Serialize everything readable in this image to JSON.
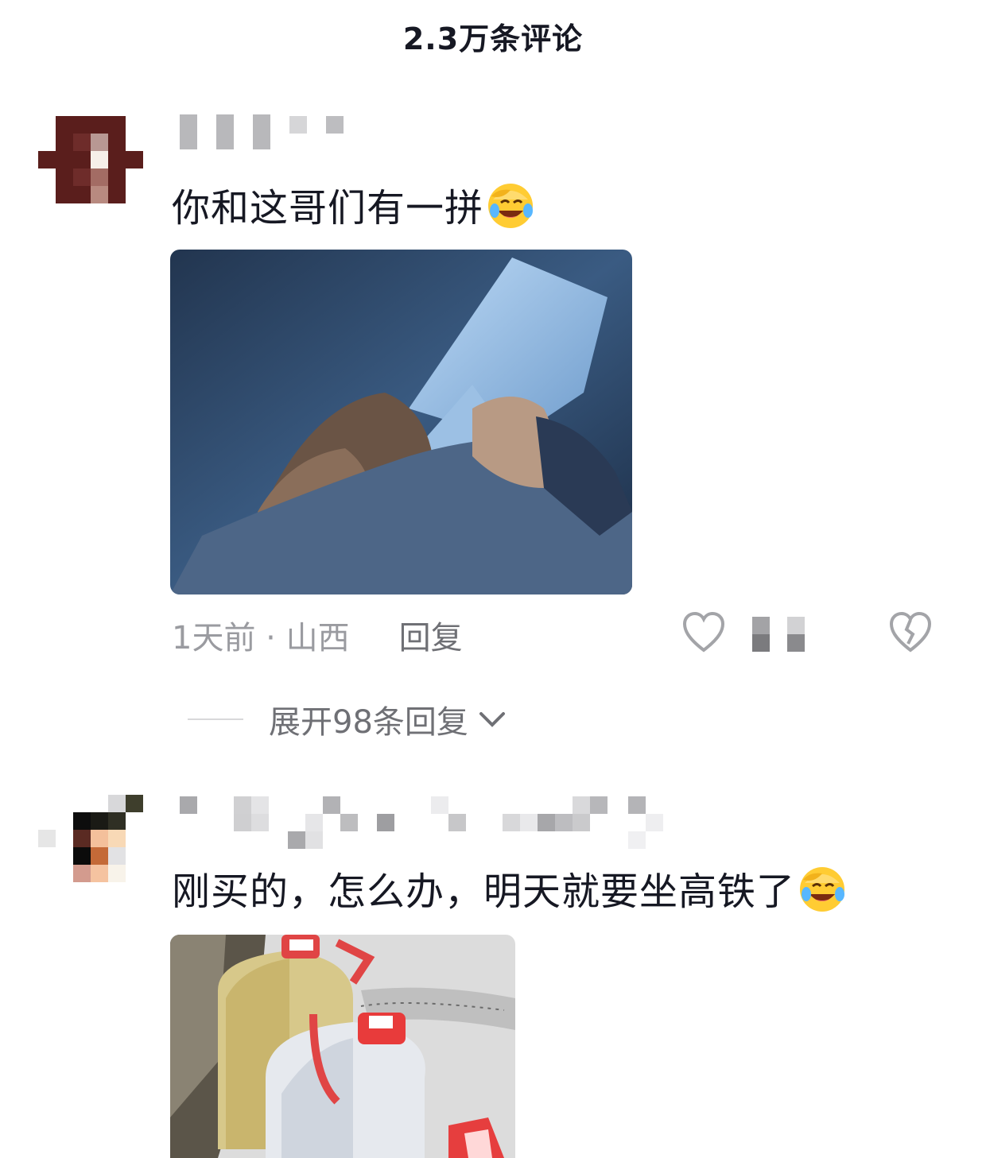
{
  "header": {
    "title": "2.3万条评论"
  },
  "comments": [
    {
      "text": "你和这哥们有一拼",
      "emoji": "laugh-cry-emoji",
      "meta": {
        "time": "1天前 · 山西",
        "reply_label": "回复"
      },
      "expand_label": "展开98条回复",
      "image_desc_icon": "photo"
    },
    {
      "text": "刚买的，怎么办，明天就要坐高铁了",
      "emoji": "laugh-cry-emoji",
      "image_desc_icon": "photo"
    }
  ],
  "colors": {
    "primary_text": "#161823",
    "secondary_text": "#9a9ba0",
    "reply_text": "#6f7075"
  }
}
